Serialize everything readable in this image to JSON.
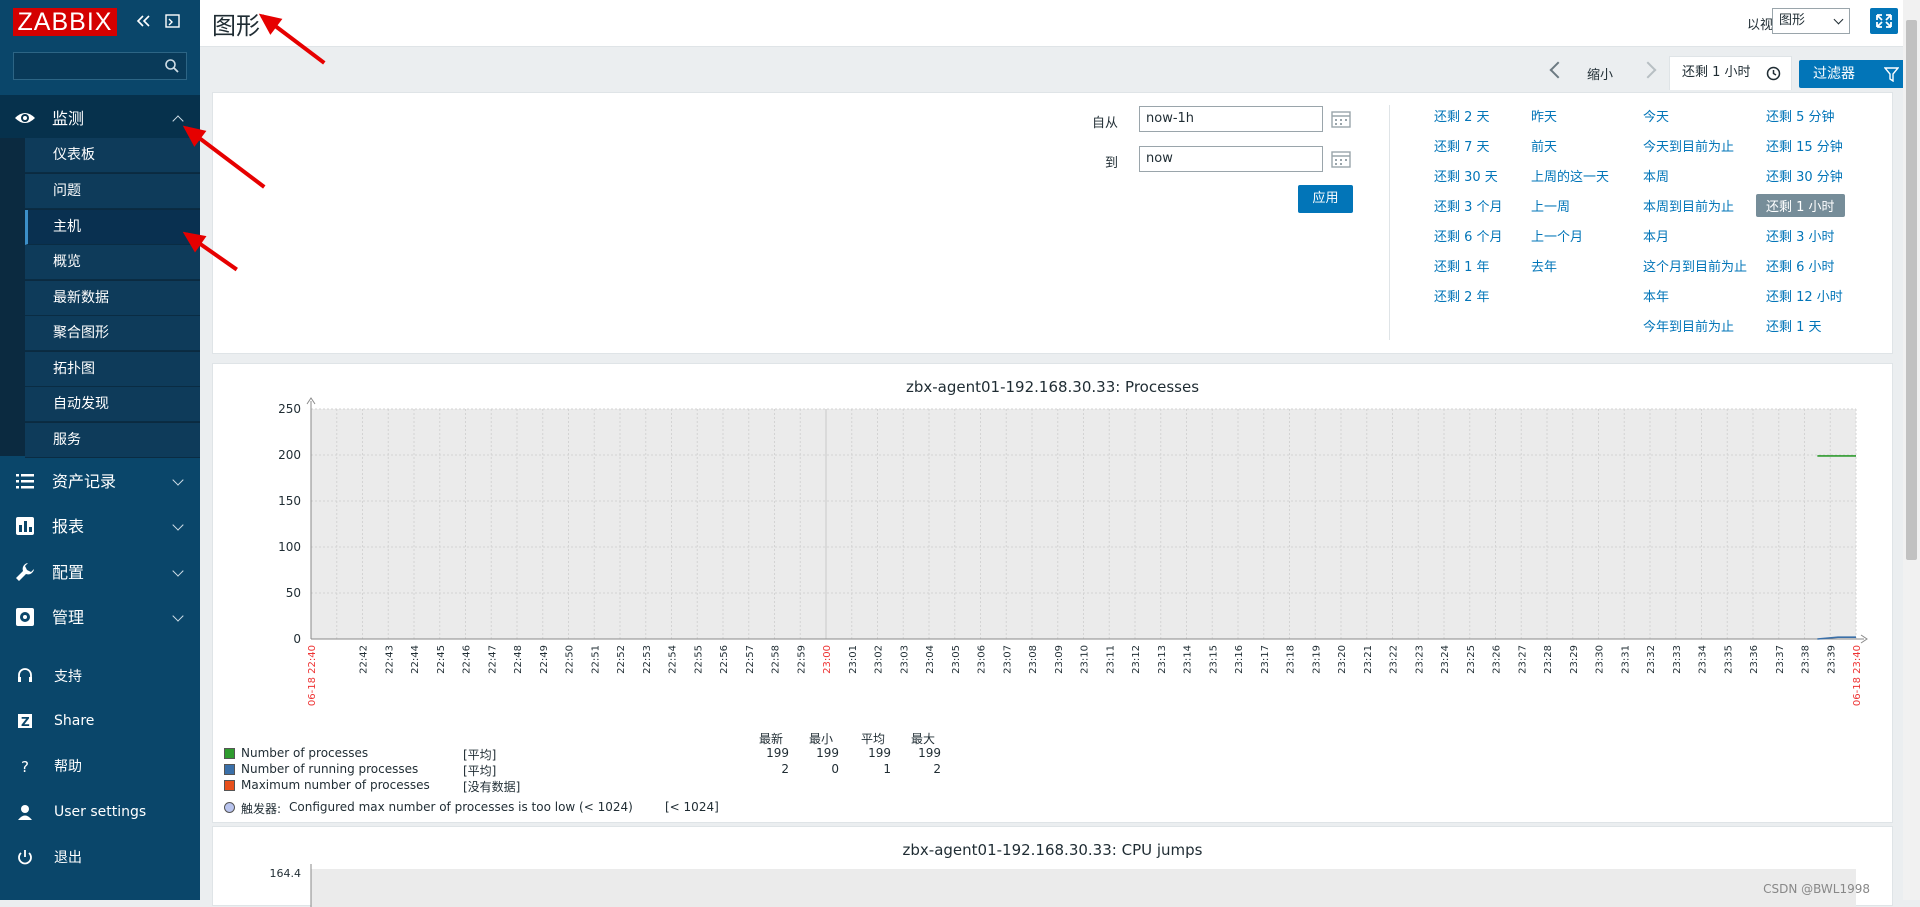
{
  "app": {
    "logo": "ZABBIX"
  },
  "sidebar": {
    "search_placeholder": "",
    "sections": [
      {
        "label": "监测",
        "icon": "eye-icon",
        "expanded": true
      },
      {
        "label": "资产记录",
        "icon": "list-icon"
      },
      {
        "label": "报表",
        "icon": "bar-chart-icon"
      },
      {
        "label": "配置",
        "icon": "wrench-icon"
      },
      {
        "label": "管理",
        "icon": "gear-icon"
      }
    ],
    "monitoring_items": [
      "仪表板",
      "问题",
      "主机",
      "概览",
      "最新数据",
      "聚合图形",
      "拓扑图",
      "自动发现",
      "服务"
    ],
    "selected_item": "主机",
    "bottom": [
      {
        "label": "支持",
        "icon": "headset-icon"
      },
      {
        "label": "Share",
        "icon": "share-icon"
      },
      {
        "label": "帮助",
        "icon": "help-icon"
      },
      {
        "label": "User settings",
        "icon": "user-icon"
      },
      {
        "label": "退出",
        "icon": "power-icon"
      }
    ]
  },
  "header": {
    "title": "图形",
    "view_as_label": "以视图",
    "view_as_value": "图形"
  },
  "filter": {
    "zoom_out": "缩小",
    "time_tab": "还剩 1 小时",
    "filter_button": "过滤器",
    "from_label": "自从",
    "from_value": "now-1h",
    "to_label": "到",
    "to_value": "now",
    "apply": "应用",
    "quick": [
      [
        "还剩 2 天",
        "还剩 7 天",
        "还剩 30 天",
        "还剩 3 个月",
        "还剩 6 个月",
        "还剩 1 年",
        "还剩 2 年"
      ],
      [
        "昨天",
        "前天",
        "上周的这一天",
        "上一周",
        "上一个月",
        "去年"
      ],
      [
        "今天",
        "今天到目前为止",
        "本周",
        "本周到目前为止",
        "本月",
        "这个月到目前为止",
        "本年",
        "今年到目前为止"
      ],
      [
        "还剩 5 分钟",
        "还剩 15 分钟",
        "还剩 30 分钟",
        "还剩 1 小时",
        "还剩 3 小时",
        "还剩 6 小时",
        "还剩 12 小时",
        "还剩 1 天"
      ]
    ],
    "selected_quick": "还剩 1 小时"
  },
  "graph1": {
    "title": "zbx-agent01-192.168.30.33: Processes",
    "start_label": "06-18 22:40",
    "end_label": "06-18 23:40",
    "mid_label": "23:00",
    "stats_headers": [
      "最新",
      "最小",
      "平均",
      "最大"
    ],
    "legend": [
      {
        "name": "Number of processes",
        "func": "[平均]",
        "color": "#2e9b2e",
        "values": [
          "199",
          "199",
          "199",
          "199"
        ]
      },
      {
        "name": "Number of running processes",
        "func": "[平均]",
        "color": "#3a6fa8",
        "values": [
          "2",
          "0",
          "1",
          "2"
        ]
      },
      {
        "name": "Maximum number of processes",
        "func": "[没有数据]",
        "color": "#e8501c",
        "values": []
      }
    ],
    "trigger_prefix": "触发器:",
    "trigger_text": "Configured max number of processes is too low (< 1024)",
    "trigger_value": "[< 1024]"
  },
  "graph2": {
    "title": "zbx-agent01-192.168.30.33: CPU jumps",
    "y_top": "164.4"
  },
  "watermark": "CSDN @BWL1998",
  "chart_data": [
    {
      "type": "line",
      "title": "zbx-agent01-192.168.30.33: Processes",
      "ylim": [
        0,
        250
      ],
      "yticks": [
        0,
        50,
        100,
        150,
        200,
        250
      ],
      "x_start": "06-18 22:40",
      "x_end": "06-18 23:40",
      "x_ticks": [
        "22:42",
        "22:43",
        "22:44",
        "22:45",
        "22:46",
        "22:47",
        "22:48",
        "22:49",
        "22:50",
        "22:51",
        "22:52",
        "22:53",
        "22:54",
        "22:55",
        "22:56",
        "22:57",
        "22:58",
        "22:59",
        "23:00",
        "23:01",
        "23:02",
        "23:03",
        "23:04",
        "23:05",
        "23:06",
        "23:07",
        "23:08",
        "23:09",
        "23:10",
        "23:11",
        "23:12",
        "23:13",
        "23:14",
        "23:15",
        "23:16",
        "23:17",
        "23:18",
        "23:19",
        "23:20",
        "23:21",
        "23:22",
        "23:23",
        "23:24",
        "23:25",
        "23:26",
        "23:27",
        "23:28",
        "23:29",
        "23:30",
        "23:31",
        "23:32",
        "23:33",
        "23:34",
        "23:35",
        "23:36",
        "23:37",
        "23:38",
        "23:39"
      ],
      "series": [
        {
          "name": "Number of processes",
          "color": "#2e9b2e",
          "x_minutes": [
            58.5,
            60
          ],
          "values": [
            199,
            199
          ]
        },
        {
          "name": "Number of running processes",
          "color": "#3a6fa8",
          "x_minutes": [
            58.5,
            59.3,
            60
          ],
          "values": [
            0,
            2,
            2
          ]
        }
      ]
    }
  ]
}
